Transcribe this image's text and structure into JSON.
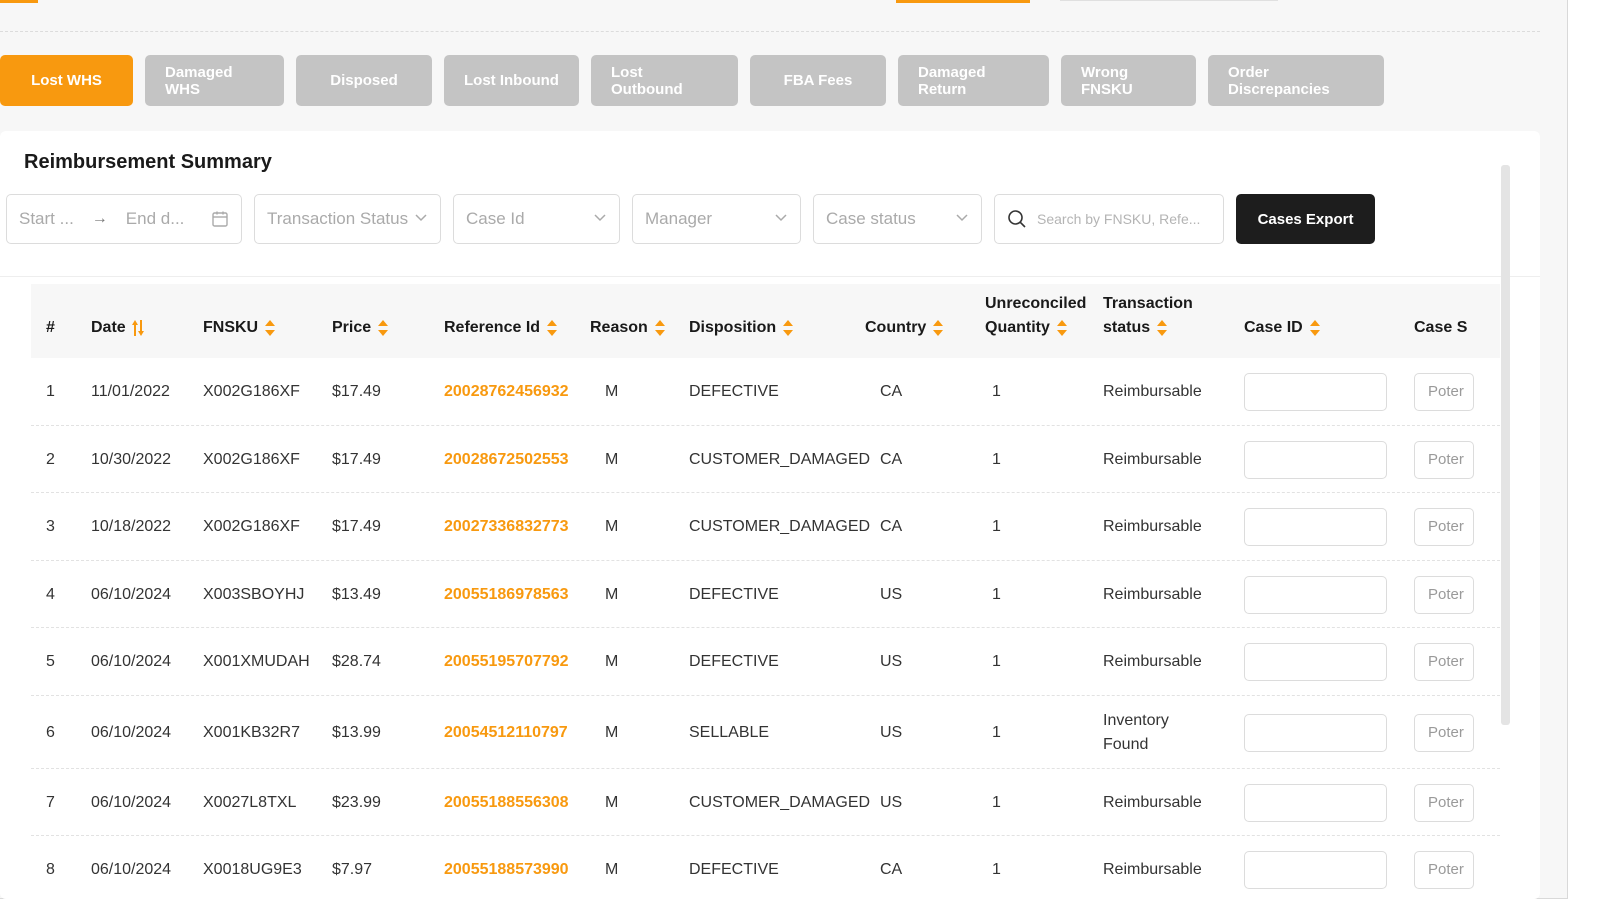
{
  "brand": {
    "accent": "#f8990f",
    "tab_inactive": "#c4c4c4",
    "dark_button": "#1d1d1d"
  },
  "tabs": [
    {
      "label": "Lost WHS",
      "active": true
    },
    {
      "label": "Damaged WHS",
      "active": false
    },
    {
      "label": "Disposed",
      "active": false
    },
    {
      "label": "Lost Inbound",
      "active": false
    },
    {
      "label": "Lost Outbound",
      "active": false
    },
    {
      "label": "FBA Fees",
      "active": false
    },
    {
      "label": "Damaged Return",
      "active": false
    },
    {
      "label": "Wrong FNSKU",
      "active": false
    },
    {
      "label": "Order Discrepancies",
      "active": false
    }
  ],
  "summary": {
    "title": "Reimbursement Summary",
    "filters": {
      "start_placeholder": "Start ...",
      "end_placeholder": "End d...",
      "transaction_status": "Transaction Status",
      "case_id": "Case Id",
      "manager": "Manager",
      "case_status": "Case status",
      "search_placeholder": "Search by FNSKU, Refe..."
    },
    "export_label": "Cases Export"
  },
  "table": {
    "headers": {
      "num": "#",
      "date": "Date",
      "fnsku": "FNSKU",
      "price": "Price",
      "reference_id": "Reference Id",
      "reason": "Reason",
      "disposition": "Disposition",
      "country": "Country",
      "unreconciled_1": "Unreconciled",
      "unreconciled_2": "Quantity",
      "transaction_1": "Transaction",
      "transaction_2": "status",
      "case_id": "Case ID",
      "case_status": "Case S"
    },
    "case_status_placeholder": "Poter",
    "rows": [
      {
        "num": "1",
        "date": "11/01/2022",
        "fnsku": "X002G186XF",
        "price": "$17.49",
        "reference_id": "20028762456932",
        "reason": "M",
        "disposition": "DEFECTIVE",
        "country": "CA",
        "quantity": "1",
        "status": "Reimbursable"
      },
      {
        "num": "2",
        "date": "10/30/2022",
        "fnsku": "X002G186XF",
        "price": "$17.49",
        "reference_id": "20028672502553",
        "reason": "M",
        "disposition": "CUSTOMER_DAMAGED",
        "country": "CA",
        "quantity": "1",
        "status": "Reimbursable"
      },
      {
        "num": "3",
        "date": "10/18/2022",
        "fnsku": "X002G186XF",
        "price": "$17.49",
        "reference_id": "20027336832773",
        "reason": "M",
        "disposition": "CUSTOMER_DAMAGED",
        "country": "CA",
        "quantity": "1",
        "status": "Reimbursable"
      },
      {
        "num": "4",
        "date": "06/10/2024",
        "fnsku": "X003SBOYHJ",
        "price": "$13.49",
        "reference_id": "20055186978563",
        "reason": "M",
        "disposition": "DEFECTIVE",
        "country": "US",
        "quantity": "1",
        "status": "Reimbursable"
      },
      {
        "num": "5",
        "date": "06/10/2024",
        "fnsku": "X001XMUDAH",
        "price": "$28.74",
        "reference_id": "20055195707792",
        "reason": "M",
        "disposition": "DEFECTIVE",
        "country": "US",
        "quantity": "1",
        "status": "Reimbursable"
      },
      {
        "num": "6",
        "date": "06/10/2024",
        "fnsku": "X001KB32R7",
        "price": "$13.99",
        "reference_id": "20054512110797",
        "reason": "M",
        "disposition": "SELLABLE",
        "country": "US",
        "quantity": "1",
        "status": "Inventory Found"
      },
      {
        "num": "7",
        "date": "06/10/2024",
        "fnsku": "X0027L8TXL",
        "price": "$23.99",
        "reference_id": "20055188556308",
        "reason": "M",
        "disposition": "CUSTOMER_DAMAGED",
        "country": "US",
        "quantity": "1",
        "status": "Reimbursable"
      },
      {
        "num": "8",
        "date": "06/10/2024",
        "fnsku": "X0018UG9E3",
        "price": "$7.97",
        "reference_id": "20055188573990",
        "reason": "M",
        "disposition": "DEFECTIVE",
        "country": "CA",
        "quantity": "1",
        "status": "Reimbursable"
      }
    ]
  }
}
